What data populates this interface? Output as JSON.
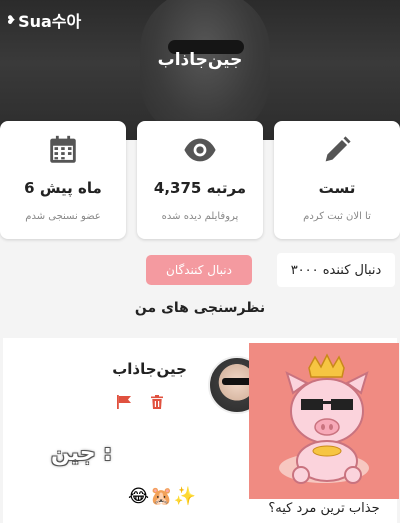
{
  "app": {
    "logo_text": "Sua수아"
  },
  "profile": {
    "name": "جین‌جاذاب"
  },
  "stats": [
    {
      "icon": "pencil-icon",
      "value": "تست",
      "label": "تا الان ثبت کردم"
    },
    {
      "icon": "eye-icon",
      "value": "4,375 مرتبه",
      "label": "پروفایلم دیده شده"
    },
    {
      "icon": "calendar-icon",
      "value": "6 ماه پیش",
      "label": "عضو نسنجی شدم"
    }
  ],
  "followers": {
    "button_label": "دنبال کنندگان",
    "count_text": "۳۰۰۰ دنبال کننده"
  },
  "section": {
    "title": "نظرسنجی های من"
  },
  "poll": {
    "author_name": "جین‌جاذاب",
    "caption": "جذاب ترین مرد کیه؟",
    "sticker_text": "جین :",
    "emoji_text": "😂🐹✨"
  },
  "colors": {
    "accent": "#f49aa0",
    "flag": "#e0513f",
    "poll_bg": "#f08b82"
  }
}
